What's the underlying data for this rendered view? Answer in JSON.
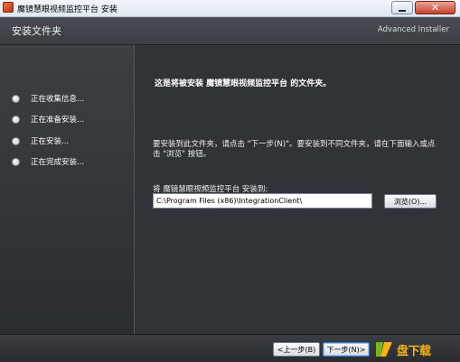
{
  "window": {
    "title": "魔镜慧眼视频监控平台 安装",
    "minimize_icon": "minimize-icon",
    "close_icon": "close-icon",
    "close_glyph": "✕"
  },
  "header": {
    "title": "安装文件夹",
    "brand": "Advanced Installer"
  },
  "steps": [
    {
      "label": "正在收集信息..."
    },
    {
      "label": "正在准备安装..."
    },
    {
      "label": "正在安装..."
    },
    {
      "label": "正在完成安装..."
    }
  ],
  "main": {
    "heading": "这是将被安装 魔镜慧眼视频监控平台 的文件夹。",
    "instructions": "要安装到此文件夹，请点击 \"下一步(N)\"。要安装到不同文件夹，请在下面输入或点击 \"浏览\" 按钮。",
    "path_label": "将 魔镜慧眼视频监控平台 安装到:",
    "path_value": "C:\\Program Files (x86)\\IntegrationClient\\",
    "browse_label": "浏览(O)..."
  },
  "footer": {
    "back_label": "<上一步(B)",
    "next_label": "下一步(N)>",
    "watermark_text": "盘下载"
  },
  "colors": {
    "panel_dark": "#2e3135",
    "accent_orange": "#f5b31a",
    "accent_green": "#7ab51d"
  }
}
